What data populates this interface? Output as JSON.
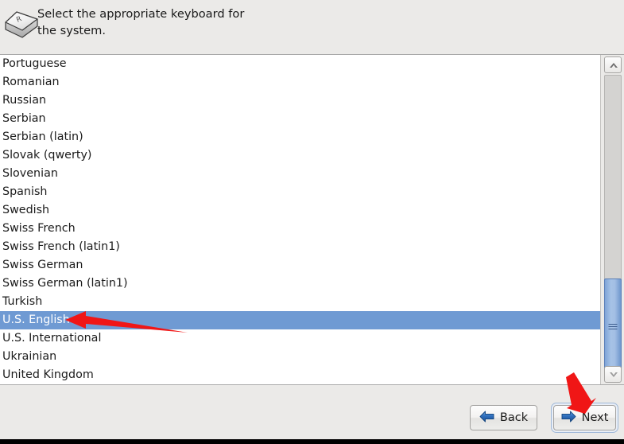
{
  "header": {
    "icon": "keyboard-key-icon",
    "icon_glyph_letter": "R",
    "instruction": "Select the appropriate keyboard for\nthe system."
  },
  "keyboard_list": {
    "name": "keyboard-layout-list",
    "selected": "U.S. English",
    "items": [
      "Portuguese",
      "Romanian",
      "Russian",
      "Serbian",
      "Serbian (latin)",
      "Slovak (qwerty)",
      "Slovenian",
      "Spanish",
      "Swedish",
      "Swiss French",
      "Swiss French (latin1)",
      "Swiss German",
      "Swiss German (latin1)",
      "Turkish",
      "U.S. English",
      "U.S. International",
      "Ukrainian",
      "United Kingdom"
    ]
  },
  "scrollbar": {
    "up_icon": "chevron-up-icon",
    "down_icon": "chevron-down-icon",
    "grip_icon": "grip-lines-icon"
  },
  "footer": {
    "back_label": "Back",
    "back_icon": "arrow-left-icon",
    "next_label": "Next",
    "next_icon": "arrow-right-icon"
  },
  "annotations": {
    "arrow_to_selection": "red-arrow-pointing-to-selected-item",
    "arrow_to_next": "red-arrow-pointing-to-next-button"
  },
  "colors": {
    "window_background": "#ebeae8",
    "list_background": "#ffffff",
    "selection_blue": "#6f9ad3",
    "annotation_red": "#f01818",
    "button_arrow_blue": "#2f6fbd",
    "text": "#1b1b1b"
  }
}
